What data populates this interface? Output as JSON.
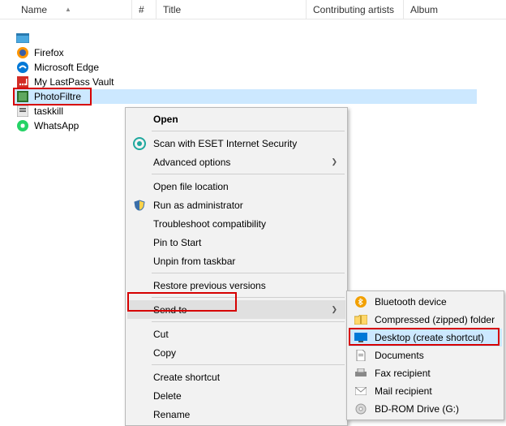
{
  "columns": {
    "name": "Name",
    "num": "#",
    "title": "Title",
    "ca": "Contributing artists",
    "album": "Album"
  },
  "files": [
    {
      "name": "",
      "icon": "window"
    },
    {
      "name": "Firefox",
      "icon": "firefox"
    },
    {
      "name": "Microsoft Edge",
      "icon": "edge"
    },
    {
      "name": "My LastPass Vault",
      "icon": "lastpass"
    },
    {
      "name": "PhotoFiltre",
      "icon": "photofiltre",
      "selected": true
    },
    {
      "name": "taskkill",
      "icon": "taskkill"
    },
    {
      "name": "WhatsApp",
      "icon": "whatsapp"
    }
  ],
  "menu": {
    "open": "Open",
    "scan": "Scan with ESET Internet Security",
    "adv": "Advanced options",
    "openloc": "Open file location",
    "runadmin": "Run as administrator",
    "troubleshoot": "Troubleshoot compatibility",
    "pin": "Pin to Start",
    "unpin": "Unpin from taskbar",
    "restore": "Restore previous versions",
    "sendto": "Send to",
    "cut": "Cut",
    "copy": "Copy",
    "shortcut": "Create shortcut",
    "delete": "Delete",
    "rename": "Rename"
  },
  "sendto": {
    "bluetooth": "Bluetooth device",
    "compressed": "Compressed (zipped) folder",
    "desktop": "Desktop (create shortcut)",
    "documents": "Documents",
    "fax": "Fax recipient",
    "mail": "Mail recipient",
    "bdrom": "BD-ROM Drive (G:)"
  }
}
